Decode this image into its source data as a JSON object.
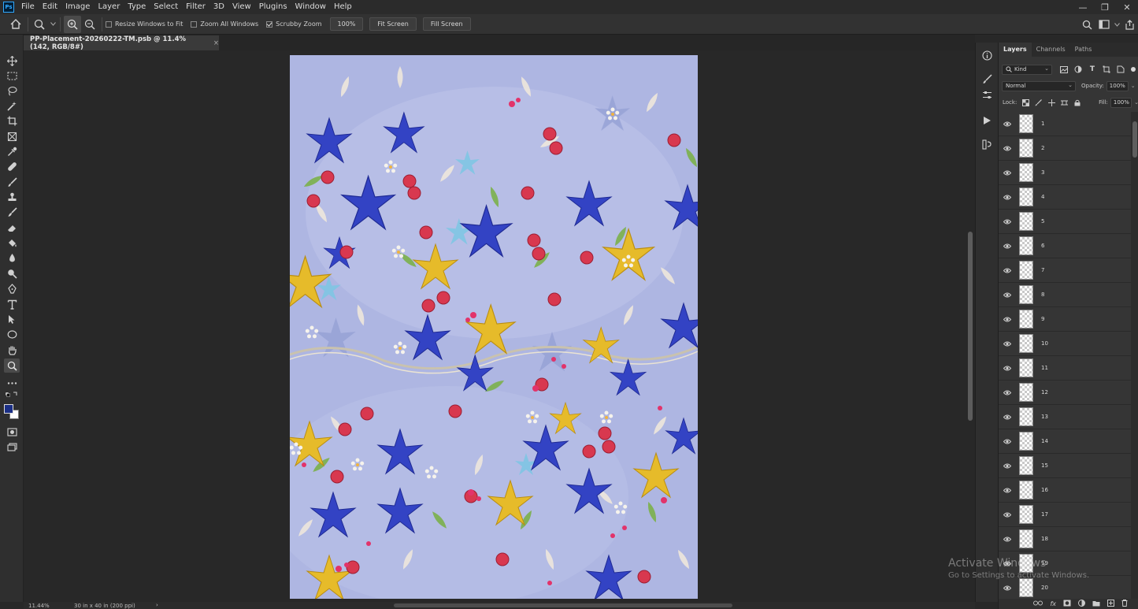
{
  "app": {
    "logo": "Ps"
  },
  "menu": [
    "File",
    "Edit",
    "Image",
    "Layer",
    "Type",
    "Select",
    "Filter",
    "3D",
    "View",
    "Plugins",
    "Window",
    "Help"
  ],
  "window_controls": [
    "—",
    "❐",
    "✕"
  ],
  "options": {
    "resize_windows": "Resize Windows to Fit",
    "zoom_all_windows": "Zoom All Windows",
    "scrubby_zoom": "Scrubby Zoom",
    "zoom_value": "100%",
    "fit_screen": "Fit Screen",
    "fill_screen": "Fill Screen"
  },
  "document": {
    "tab_title": "PP-Placement-20260222-TM.psb @ 11.4% (142, RGB/8#)",
    "close": "×"
  },
  "status": {
    "zoom": "11.44%",
    "dimensions": "30 in x 40 in (200 ppi)",
    "arrow": "›"
  },
  "panel": {
    "tabs": [
      "Layers",
      "Channels",
      "Paths"
    ],
    "kind_label": "Kind",
    "blend_mode": "Normal",
    "opacity_label": "Opacity:",
    "opacity_value": "100%",
    "lock_label": "Lock:",
    "fill_label": "Fill:",
    "fill_value": "100%",
    "layers": [
      "1",
      "2",
      "3",
      "4",
      "5",
      "6",
      "7",
      "8",
      "9",
      "10",
      "11",
      "12",
      "13",
      "14",
      "15",
      "16",
      "17",
      "18",
      "19",
      "20"
    ],
    "footer_fx": "fx"
  },
  "watermark": {
    "title": "Activate Windows",
    "subtitle": "Go to Settings to activate Windows."
  },
  "colors": {
    "foreground": "#1b2f86",
    "background": "#ffffff",
    "canvas_bg": "#b0b8e4"
  }
}
